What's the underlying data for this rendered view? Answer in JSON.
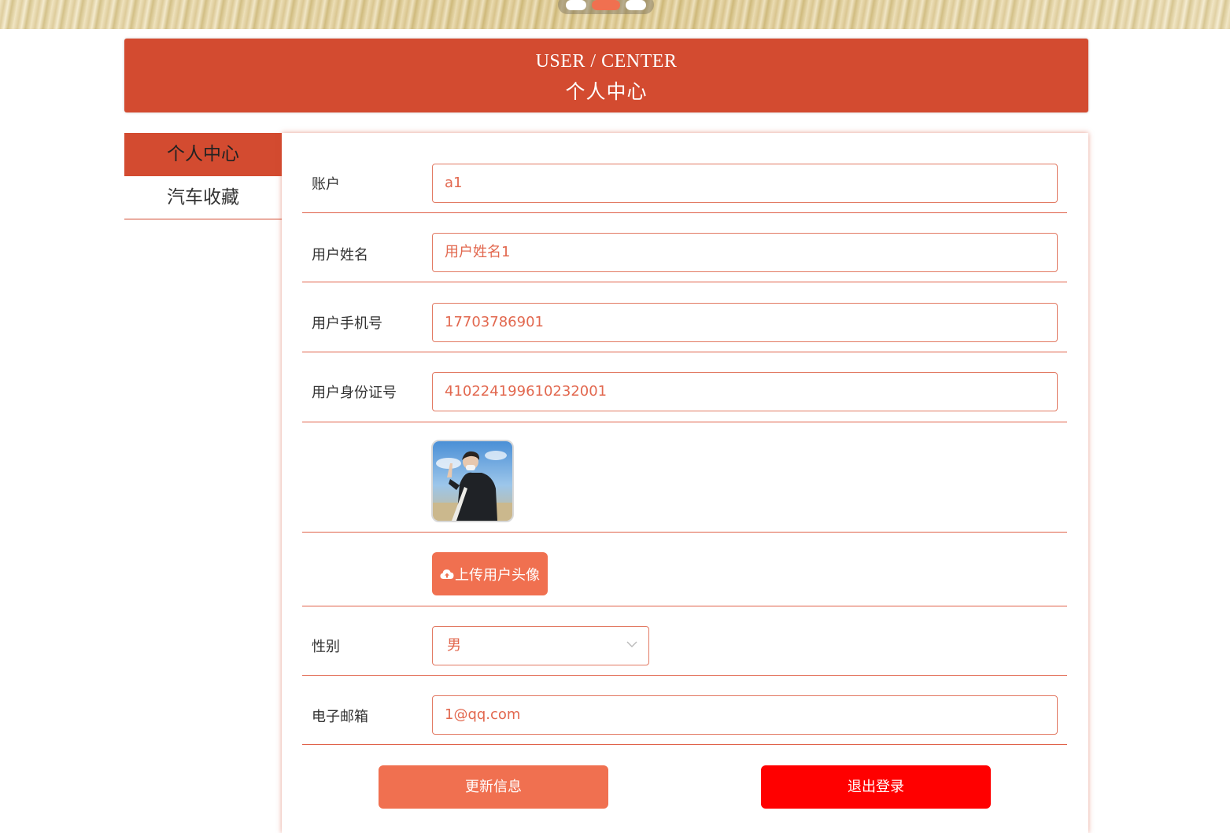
{
  "header": {
    "title_en": "USER / CENTER",
    "title_cn": "个人中心"
  },
  "sidebar": {
    "items": [
      {
        "label": "个人中心",
        "active": true
      },
      {
        "label": "汽车收藏",
        "active": false
      }
    ]
  },
  "form": {
    "account": {
      "label": "账户",
      "value": "a1"
    },
    "name": {
      "label": "用户姓名",
      "value": "用户姓名1"
    },
    "phone": {
      "label": "用户手机号",
      "value": "17703786901"
    },
    "id_card": {
      "label": "用户身份证号",
      "value": "410224199610232001"
    },
    "upload_label": "上传用户头像",
    "gender": {
      "label": "性别",
      "value": "男"
    },
    "email": {
      "label": "电子邮箱",
      "value": "1@qq.com"
    }
  },
  "actions": {
    "update_label": "更新信息",
    "logout_label": "退出登录"
  },
  "colors": {
    "primary": "#d34b30",
    "accent": "#f07050",
    "danger": "#ff0000",
    "input_text": "#e2684f"
  },
  "carousel": {
    "slides": 3,
    "active_index": 1
  }
}
